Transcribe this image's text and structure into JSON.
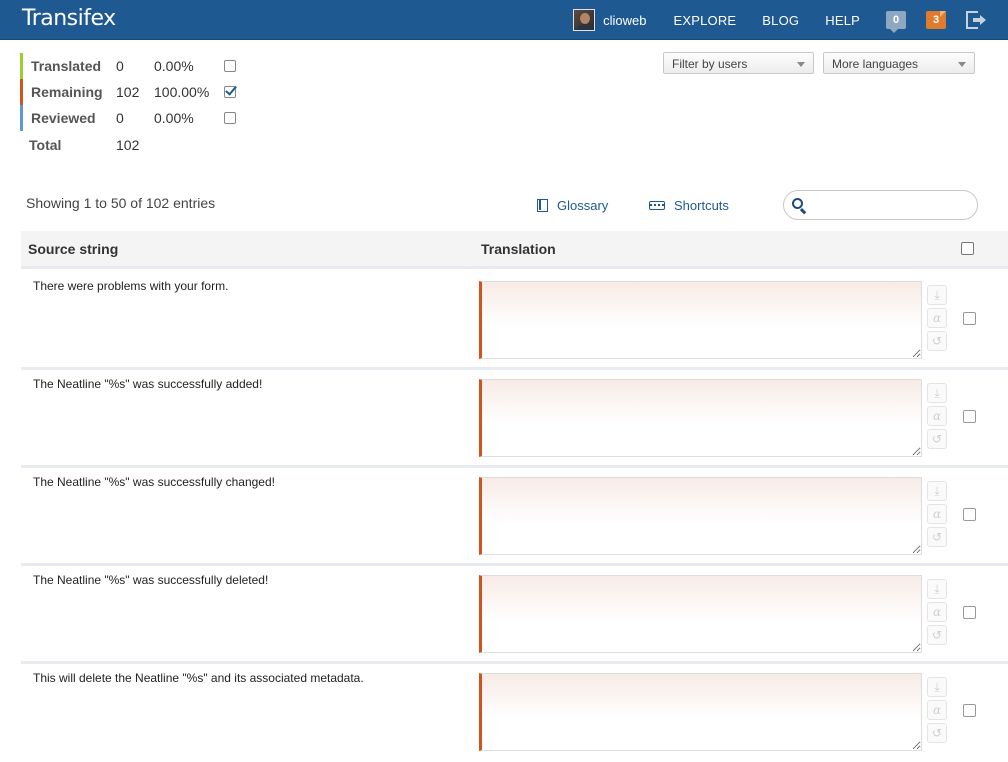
{
  "header": {
    "logo": "Transifex",
    "username": "clioweb",
    "nav": [
      "EXPLORE",
      "BLOG",
      "HELP"
    ],
    "messages_count": "0",
    "notifications_count": "3",
    "icons": {
      "messages": "speech-bubble-icon",
      "notifications": "note-icon",
      "logout": "logout-icon"
    }
  },
  "stats": {
    "items": [
      {
        "label": "Translated",
        "count": "0",
        "percent": "0.00%",
        "checked": false,
        "color": "#9ccc2e"
      },
      {
        "label": "Remaining",
        "count": "102",
        "percent": "100.00%",
        "checked": true,
        "color": "#d2541d"
      },
      {
        "label": "Reviewed",
        "count": "0",
        "percent": "0.00%",
        "checked": false,
        "color": "#5a9ad8"
      }
    ],
    "total_label": "Total",
    "total_count": "102"
  },
  "filters": {
    "users": "Filter by users",
    "languages": "More languages"
  },
  "toolbar": {
    "showing": "Showing 1 to 50 of 102 entries",
    "glossary": "Glossary",
    "shortcuts": "Shortcuts",
    "search_placeholder": ""
  },
  "table": {
    "col_source": "Source string",
    "col_translation": "Translation",
    "rows": [
      {
        "source": "There were problems with your form.",
        "translation": ""
      },
      {
        "source": "The Neatline \"%s\" was successfully added!",
        "translation": ""
      },
      {
        "source": "The Neatline \"%s\" was successfully changed!",
        "translation": ""
      },
      {
        "source": "The Neatline \"%s\" was successfully deleted!",
        "translation": ""
      },
      {
        "source": "This will delete the Neatline \"%s\" and its associated metadata.",
        "translation": ""
      }
    ],
    "actions": {
      "copy": "⤓",
      "machine": "α",
      "undo": "↺"
    }
  }
}
